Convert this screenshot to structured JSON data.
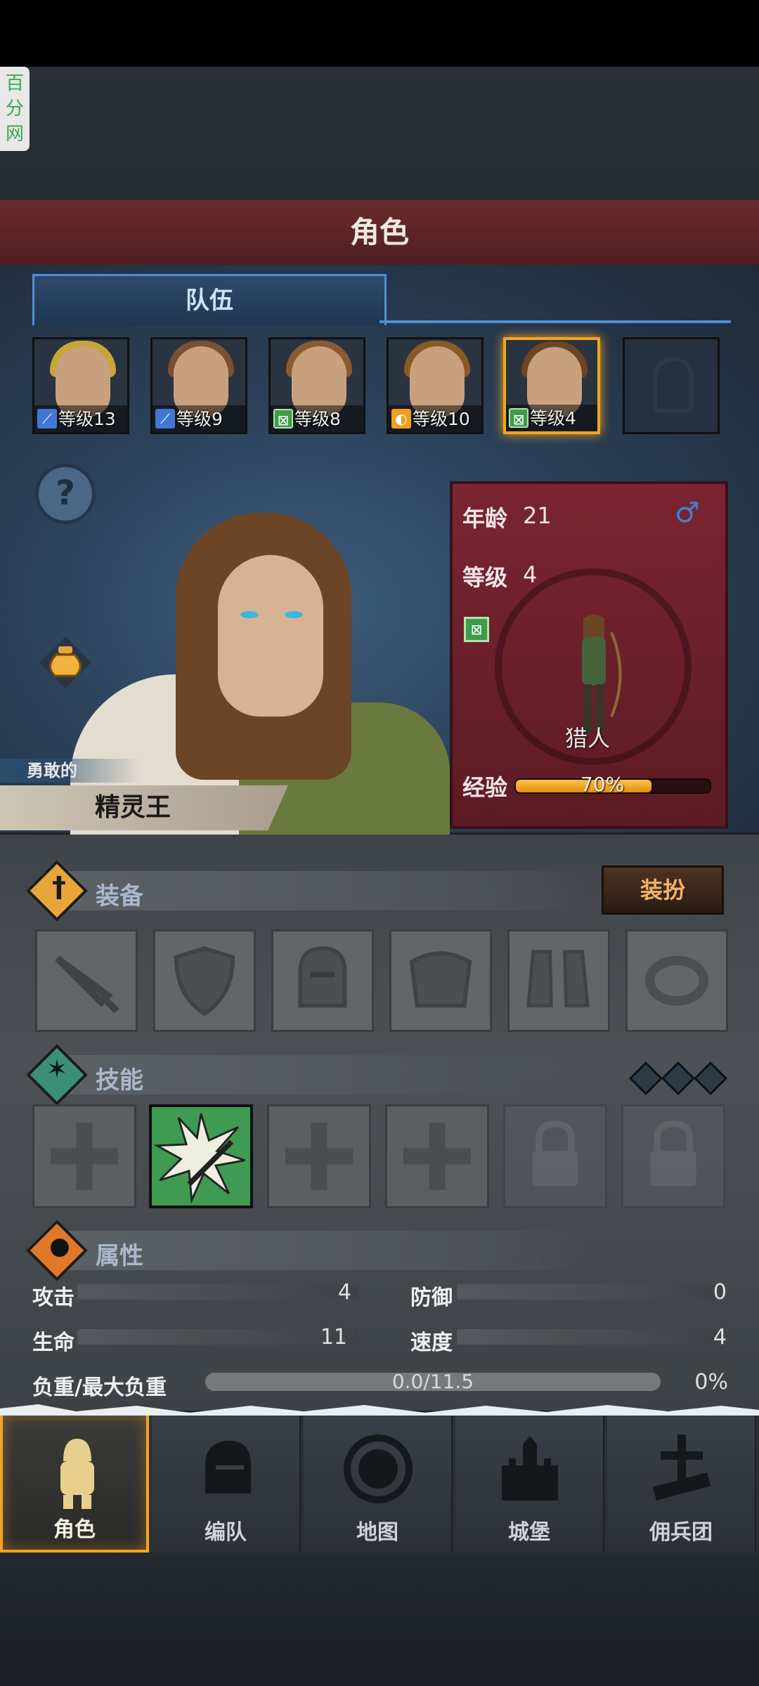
{
  "watermark": {
    "text": "百分网"
  },
  "header": {
    "title": "角色"
  },
  "tabs": {
    "team": "队伍"
  },
  "roster": [
    {
      "level": "等级13",
      "class_icon": "sword-icon",
      "hair": "#c9a43a"
    },
    {
      "level": "等级9",
      "class_icon": "sword-icon",
      "hair": "#7a5030"
    },
    {
      "level": "等级8",
      "class_icon": "bow-icon",
      "hair": "#8a5a32"
    },
    {
      "level": "等级10",
      "class_icon": "shield-icon",
      "hair": "#8a5a25"
    },
    {
      "level": "等级4",
      "class_icon": "bow-icon",
      "hair": "#6b4526",
      "selected": true
    }
  ],
  "hero": {
    "trait": "勇敢的",
    "name": "精灵王",
    "age_label": "年龄",
    "age": "21",
    "gender_symbol": "♂",
    "level_label": "等级",
    "level": "4",
    "class_name": "猎人",
    "xp_label": "经验",
    "xp_text": "70%",
    "xp_fraction": 0.7
  },
  "equipment": {
    "title": "装备",
    "dress_button": "装扮",
    "slots": [
      "sword-slot-icon",
      "shield-slot-icon",
      "helmet-slot-icon",
      "armor-slot-icon",
      "boots-slot-icon",
      "ring-slot-icon"
    ]
  },
  "skills": {
    "title": "技能"
  },
  "attributes": {
    "title": "属性",
    "attack_label": "攻击",
    "attack": "4",
    "defense_label": "防御",
    "defense": "0",
    "hp_label": "生命",
    "hp": "11",
    "speed_label": "速度",
    "speed": "4",
    "load_label": "负重/最大负重",
    "load": "0.0/11.5",
    "load_pct": "0%"
  },
  "nav": [
    {
      "label": "角色",
      "active": true
    },
    {
      "label": "编队"
    },
    {
      "label": "地图"
    },
    {
      "label": "城堡"
    },
    {
      "label": "佣兵团"
    }
  ]
}
